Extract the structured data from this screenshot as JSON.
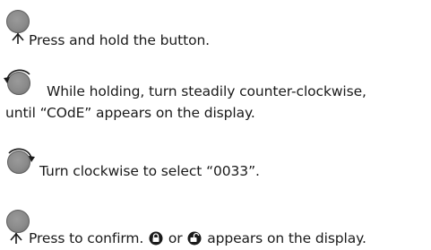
{
  "steps": [
    {
      "text": "Press and hold the button."
    },
    {
      "line1": "While holding, turn steadily counter-clockwise,",
      "line2": "until “COdE” appears on the display."
    },
    {
      "text": "Turn clockwise to select “0033”."
    },
    {
      "before": "Press to confirm.",
      "or": "or",
      "after": "appears on the display."
    }
  ],
  "icons": {
    "step1": [
      "knob-icon",
      "press-arrow-icon"
    ],
    "step2": [
      "knob-icon",
      "counter-clockwise-arrow-icon"
    ],
    "step3": [
      "knob-icon",
      "clockwise-arrow-icon"
    ],
    "step4": [
      "knob-icon",
      "press-arrow-icon",
      "lock-icon",
      "unlock-icon"
    ]
  },
  "colors": {
    "knob": "#8a8a8a",
    "text": "#1a1a1a"
  }
}
